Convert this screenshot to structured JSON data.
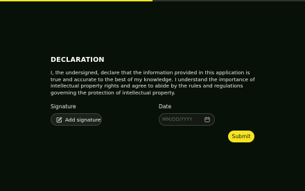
{
  "progress": {
    "fraction": 0.5,
    "fill_color": "#f5e520",
    "track_color": "#2c332c"
  },
  "section": {
    "title": "DECLARATION",
    "text": "I, the undersigned, declare that the information provided in this application is true and accurate to the best of my knowledge. I understand the importance of intellectual property rights and agree to abide by the rules and regulations governing the protection of intellectual property."
  },
  "signature": {
    "label": "Signature",
    "button_label": "Add signature",
    "icon": "edit-icon"
  },
  "date": {
    "label": "Date",
    "value": "",
    "placeholder": "MM/DD/YYYY",
    "icon": "calendar-icon"
  },
  "submit": {
    "label": "Submit",
    "color": "#f5e520"
  }
}
